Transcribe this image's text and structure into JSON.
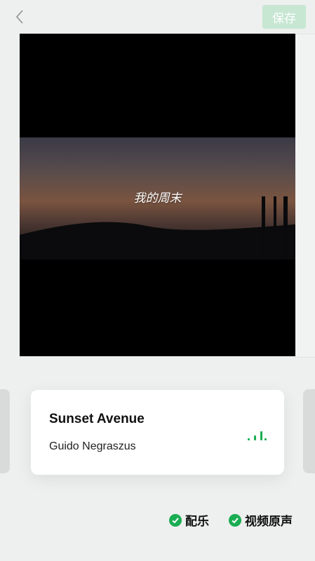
{
  "header": {
    "back_icon": "chevron-left-icon",
    "save_label": "保存",
    "save_color": "#c7e7d3"
  },
  "video": {
    "subtitle": "我的周末"
  },
  "music": {
    "title": "Sunset Avenue",
    "artist": "Guido Negraszus",
    "playing_icon": "equalizer-icon",
    "accent": "#1aad53"
  },
  "options": [
    {
      "label": "配乐",
      "checked": true
    },
    {
      "label": "视频原声",
      "checked": true
    }
  ]
}
